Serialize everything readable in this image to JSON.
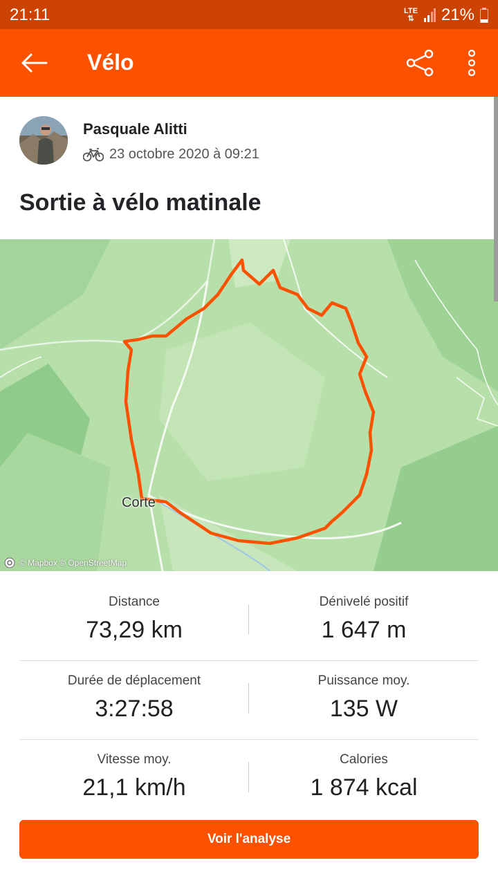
{
  "status_bar": {
    "time": "21:11",
    "network": "LTE",
    "battery": "21%"
  },
  "toolbar": {
    "title": "Vélo"
  },
  "header": {
    "athlete": "Pasquale Alitti",
    "date": "23 octobre 2020 à 09:21",
    "activity_title": "Sortie à vélo matinale"
  },
  "map": {
    "city_label": "Corte",
    "attribution": "© Mapbox © OpenStreetMap",
    "route_color": "#fc5200"
  },
  "stats": [
    {
      "left": {
        "label": "Distance",
        "value": "73,29 km"
      },
      "right": {
        "label": "Dénivelé positif",
        "value": "1 647 m"
      }
    },
    {
      "left": {
        "label": "Durée de déplacement",
        "value": "3:27:58"
      },
      "right": {
        "label": "Puissance moy.",
        "value": "135 W"
      }
    },
    {
      "left": {
        "label": "Vitesse moy.",
        "value": "21,1 km/h"
      },
      "right": {
        "label": "Calories",
        "value": "1 874 kcal"
      }
    }
  ],
  "cta": {
    "label": "Voir l'analyse"
  },
  "colors": {
    "brand": "#fc5200",
    "status_bar": "#cc4200"
  }
}
